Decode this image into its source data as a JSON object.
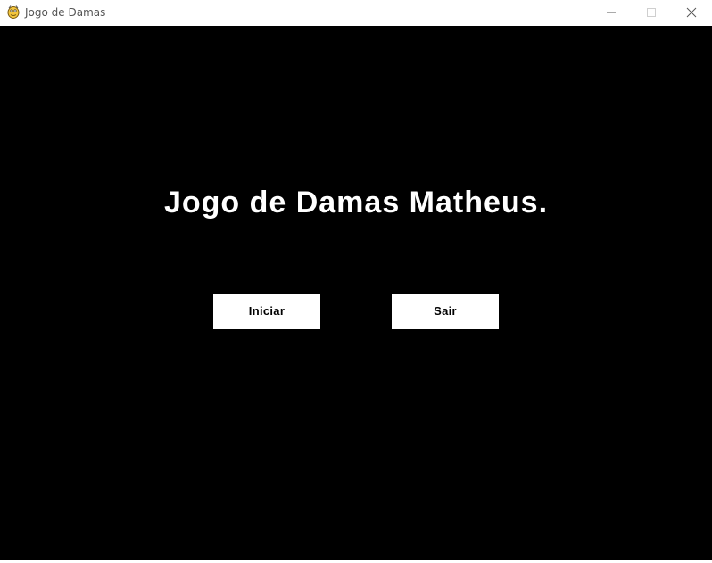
{
  "window": {
    "title": "Jogo de Damas",
    "icon": "pygame-snake-icon"
  },
  "controls": {
    "minimize_icon": "minimize-icon",
    "maximize_icon": "maximize-icon",
    "close_icon": "close-icon"
  },
  "screen": {
    "title": "Jogo de Damas Matheus.",
    "background_color": "#000000",
    "text_color": "#ffffff"
  },
  "menu": {
    "start_label": "Iniciar",
    "quit_label": "Sair",
    "button_color": "#ffffff",
    "button_text_color": "#000000"
  }
}
